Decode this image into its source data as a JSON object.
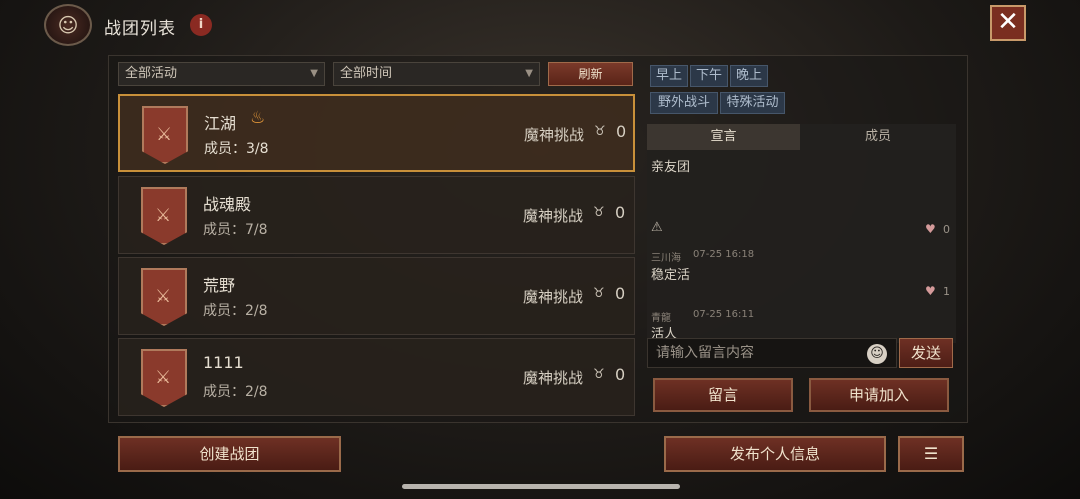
{
  "header": {
    "title": "战团列表",
    "info_glyph": "i",
    "close_glyph": "✕"
  },
  "filters": {
    "activity": "全部活动",
    "time": "全部时间",
    "refresh": "刷新"
  },
  "teams": [
    {
      "name": "江湖",
      "members": "成员：3/8",
      "challenge": "魔神挑战",
      "count": "0",
      "selected": true
    },
    {
      "name": "战魂殿",
      "members": "成员：7/8",
      "challenge": "魔神挑战",
      "count": "0",
      "selected": false
    },
    {
      "name": "荒野",
      "members": "成员：2/8",
      "challenge": "魔神挑战",
      "count": "0",
      "selected": false
    },
    {
      "name": "1111",
      "members": "成员：2/8",
      "challenge": "魔神挑战",
      "count": "0",
      "selected": false
    }
  ],
  "tags": [
    "早上",
    "下午",
    "晚上",
    "野外战斗",
    "特殊活动"
  ],
  "tabs": {
    "declaration": "宣言",
    "members": "成员"
  },
  "messages": {
    "declaration": "亲友团",
    "declaration_likes": "0",
    "posts": [
      {
        "author": "三川海",
        "time": "07-25 16:18",
        "text": "稳定活",
        "likes": "1"
      },
      {
        "author": "青龍",
        "time": "07-25 16:11",
        "text": "活人"
      }
    ]
  },
  "input": {
    "placeholder": "请输入留言内容",
    "send": "发送"
  },
  "actions": {
    "leave_message": "留言",
    "apply_join": "申请加入"
  },
  "bottom": {
    "create": "创建战团",
    "publish": "发布个人信息",
    "doc_glyph": "☰"
  },
  "icons": [
    "team-emblem-icon",
    "info-icon",
    "close-icon",
    "chevron-down-icon",
    "banner-icon",
    "flame-icon",
    "horn-icon",
    "warning-icon",
    "heart-icon",
    "emoji-icon",
    "document-icon"
  ],
  "colors": {
    "accent": "#c8903a",
    "button": "#6e3024",
    "chip": "#2c3848"
  }
}
